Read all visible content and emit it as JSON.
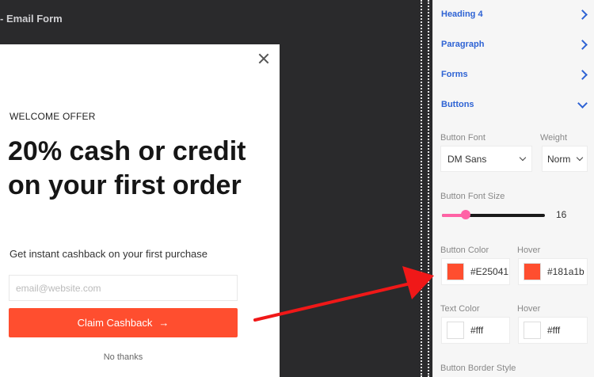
{
  "canvas": {
    "breadcrumb": "- Email Form"
  },
  "popup": {
    "eyebrow": "WELCOME OFFER",
    "headline": "20% cash or credit on your first order",
    "subtitle": "Get instant cashback on your first purchase",
    "email_placeholder": "email@website.com",
    "cta_label": "Claim Cashback",
    "cta_arrow": "→",
    "dismiss_label": "No thanks"
  },
  "panel": {
    "sections": [
      {
        "label": "Heading 4",
        "expanded": false
      },
      {
        "label": "Paragraph",
        "expanded": false
      },
      {
        "label": "Forms",
        "expanded": false
      },
      {
        "label": "Buttons",
        "expanded": true
      }
    ],
    "button_font": {
      "label": "Button Font",
      "value": "DM Sans"
    },
    "weight": {
      "label": "Weight",
      "value": "Norm"
    },
    "font_size": {
      "label": "Button Font Size",
      "value": "16",
      "slider_fraction": 0.23
    },
    "button_color": {
      "label": "Button Color",
      "hex": "#E25041",
      "swatch": "#ff4e2f"
    },
    "button_hover": {
      "label": "Hover",
      "hex": "#181a1b",
      "swatch": "#ff4e2f"
    },
    "text_color": {
      "label": "Text Color",
      "hex": "#fff",
      "swatch": "#ffffff"
    },
    "text_hover": {
      "label": "Hover",
      "hex": "#fff",
      "swatch": "#ffffff"
    },
    "border_style": {
      "label": "Button Border Style"
    }
  },
  "colors": {
    "accent": "#ff4e2f",
    "link": "#2e63d4",
    "slider": "#ff62a5",
    "annotation_arrow": "#f01818"
  }
}
